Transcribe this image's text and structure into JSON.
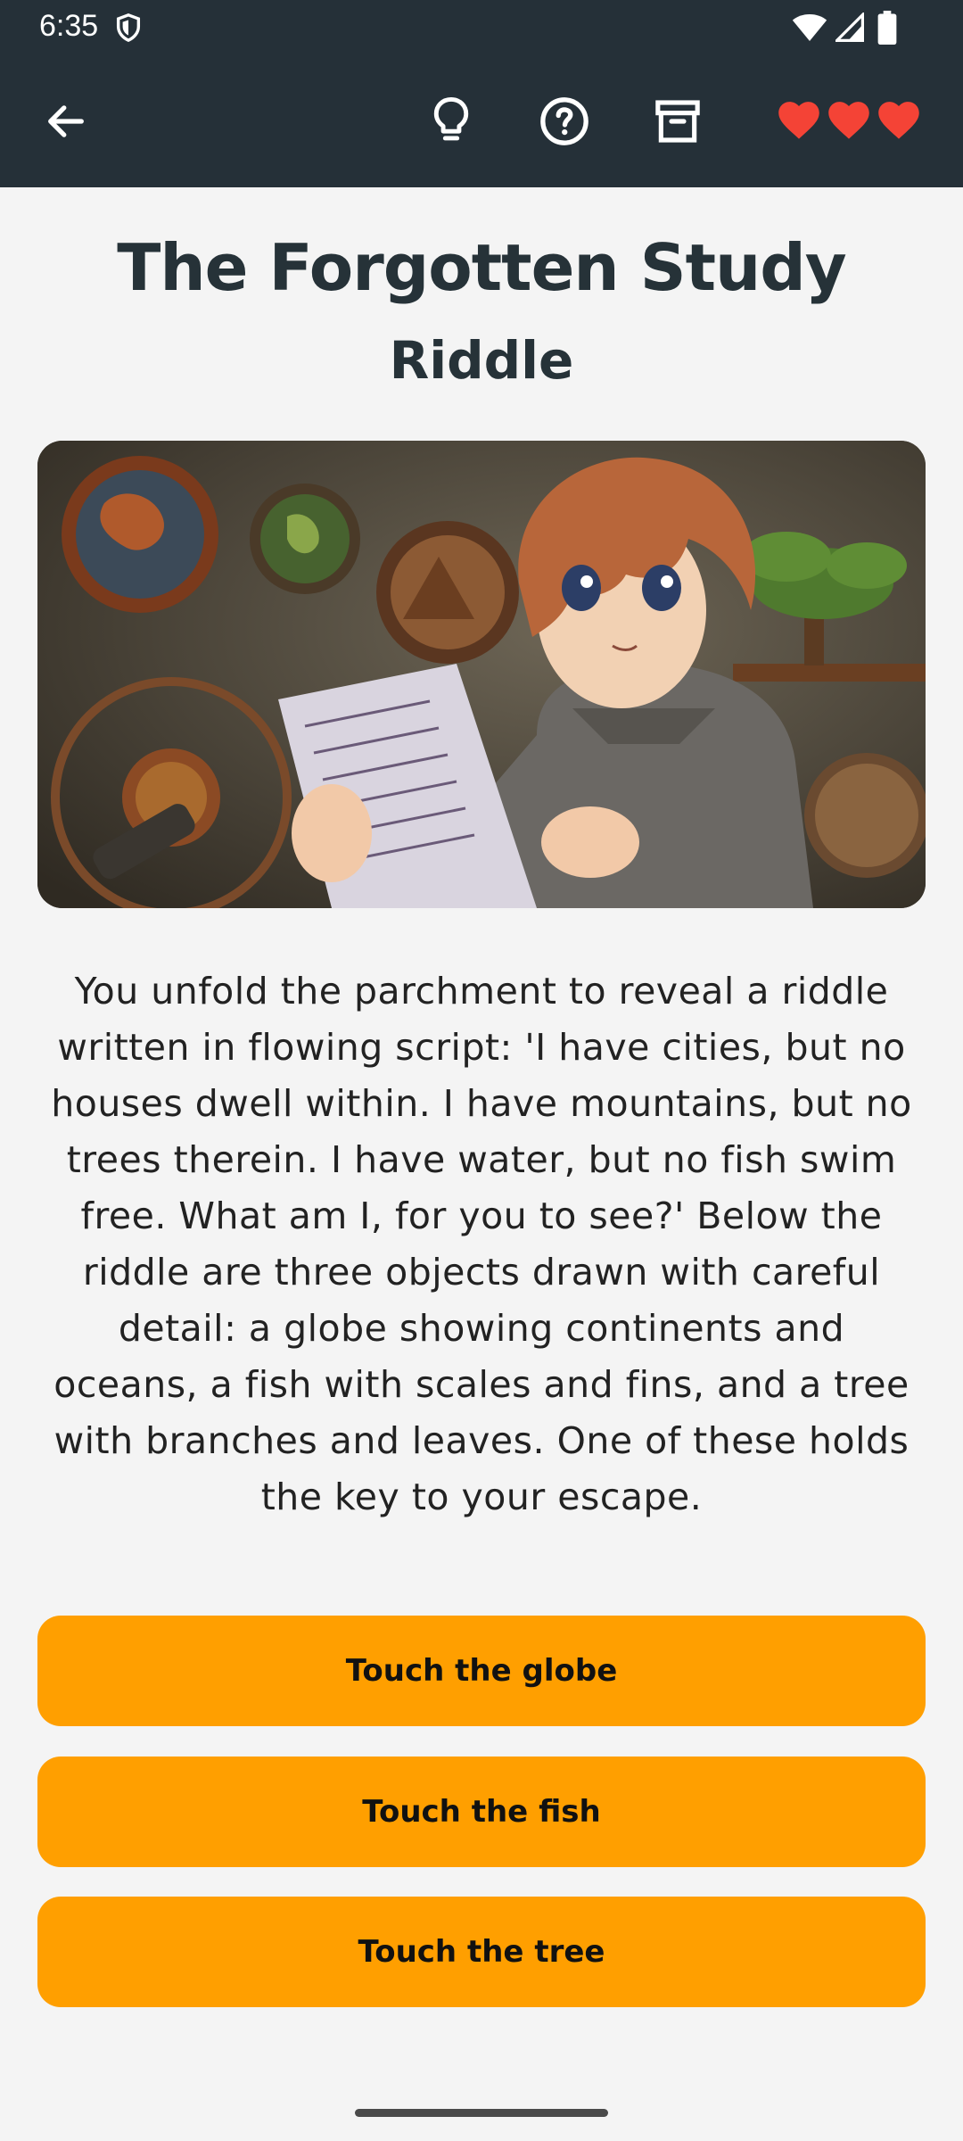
{
  "status_bar": {
    "time": "6:35"
  },
  "app_bar": {
    "icons": [
      "back-arrow-icon",
      "lightbulb-icon",
      "help-circle-icon",
      "archive-icon"
    ],
    "lives": 3,
    "heart_color": "#f44336",
    "background": "#253038"
  },
  "page": {
    "title": "The Forgotten Study",
    "subtitle": "Riddle",
    "story": "You unfold the parchment to reveal a riddle written in flowing script: 'I have cities, but no houses dwell within. I have mountains, but no trees therein. I have water, but no fish swim free. What am I, for you to see?' Below the riddle are three objects drawn with careful detail: a globe showing continents and oceans, a fish with scales and fins, and a tree with branches and leaves. One of these holds the key to your escape."
  },
  "choices": [
    {
      "label": "Touch the globe"
    },
    {
      "label": "Touch the fish"
    },
    {
      "label": "Touch the tree"
    }
  ],
  "colors": {
    "accent": "#ff9f00",
    "background": "#f4f4f4",
    "text": "#263238"
  }
}
